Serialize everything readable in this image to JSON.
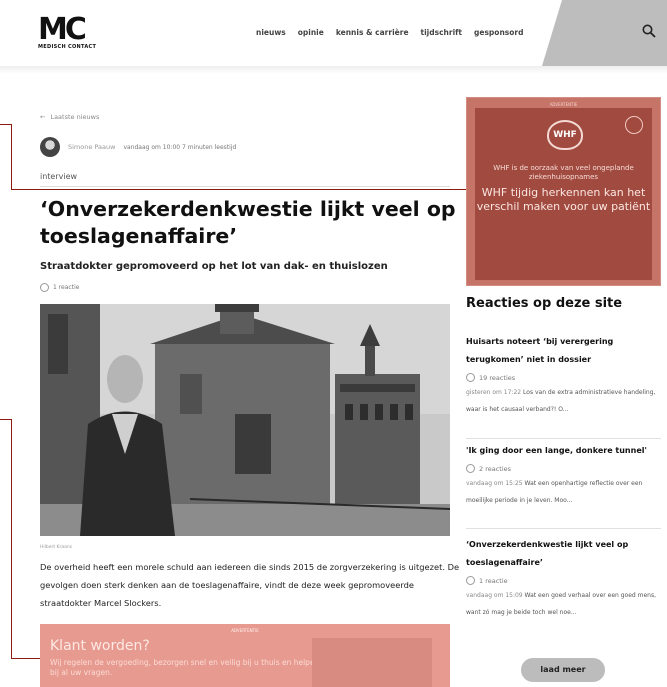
{
  "header": {
    "logo_mark": "MC",
    "logo_sub": "MEDISCH CONTACT",
    "nav": [
      "nieuws",
      "opinie",
      "kennis & carrière",
      "tijdschrift",
      "gesponsord"
    ]
  },
  "article": {
    "back_label": "Laatste nieuws",
    "author": "Simone Paauw",
    "meta": "vandaag om 10:00   7 minuten leestijd",
    "kicker": "interview",
    "title": "‘Onverzekerdenkwestie lijkt veel op toeslagenaffaire’",
    "subtitle": "Straatdokter gepromoveerd op het lot van dak- en thuislozen",
    "reactions": "1 reactie",
    "caption": "Hilbert Kraans",
    "body": "De overheid heeft een morele schuld aan iedereen die sinds 2015 de zorgverzekering is uitgezet. De gevolgen doen sterk denken aan de toeslagenaffaire, vindt de deze week gepromoveerde straatdokter Marcel Slockers."
  },
  "ad_top": {
    "label": "ADVERTENTIE",
    "logo": "WHF",
    "line1": "WHF is de oorzaak van veel ongeplande ziekenhuisopnames",
    "line2": "WHF tijdig herkennen kan het verschil maken voor uw patiënt"
  },
  "ad_bottom": {
    "label": "ADVERTENTIE",
    "title": "Klant worden?",
    "sub": "Wij regelen de vergoeding, bezorgen snel en veilig bij u thuis en helpen bij al uw vragen."
  },
  "sidebar": {
    "title": "Reacties op deze site",
    "items": [
      {
        "title": "Huisarts noteert ‘bij verergering terugkomen’ niet in dossier",
        "reactions": "19 reacties",
        "time": "gisteren om 17:22",
        "snippet": "Los van de extra administratieve handeling, waar is het causaal verband?! O..."
      },
      {
        "title": "'Ik ging door een lange, donkere tunnel'",
        "reactions": "2 reacties",
        "time": "vandaag om 15:25",
        "snippet": "Wat een openhartige reflectie over een moeilijke periode in je leven. Moo..."
      },
      {
        "title": "‘Onverzekerdenkwestie lijkt veel op toeslagenaffaire’",
        "reactions": "1 reactie",
        "time": "vandaag om 15:09",
        "snippet": "Wat een goed verhaal over een goed mens, want zó mag je beide toch wel noe..."
      }
    ],
    "more_label": "laad meer"
  },
  "colors": {
    "ad_red": "#a14a3f",
    "ad_pink": "#e79a8f",
    "connector": "#8a1b0e"
  }
}
